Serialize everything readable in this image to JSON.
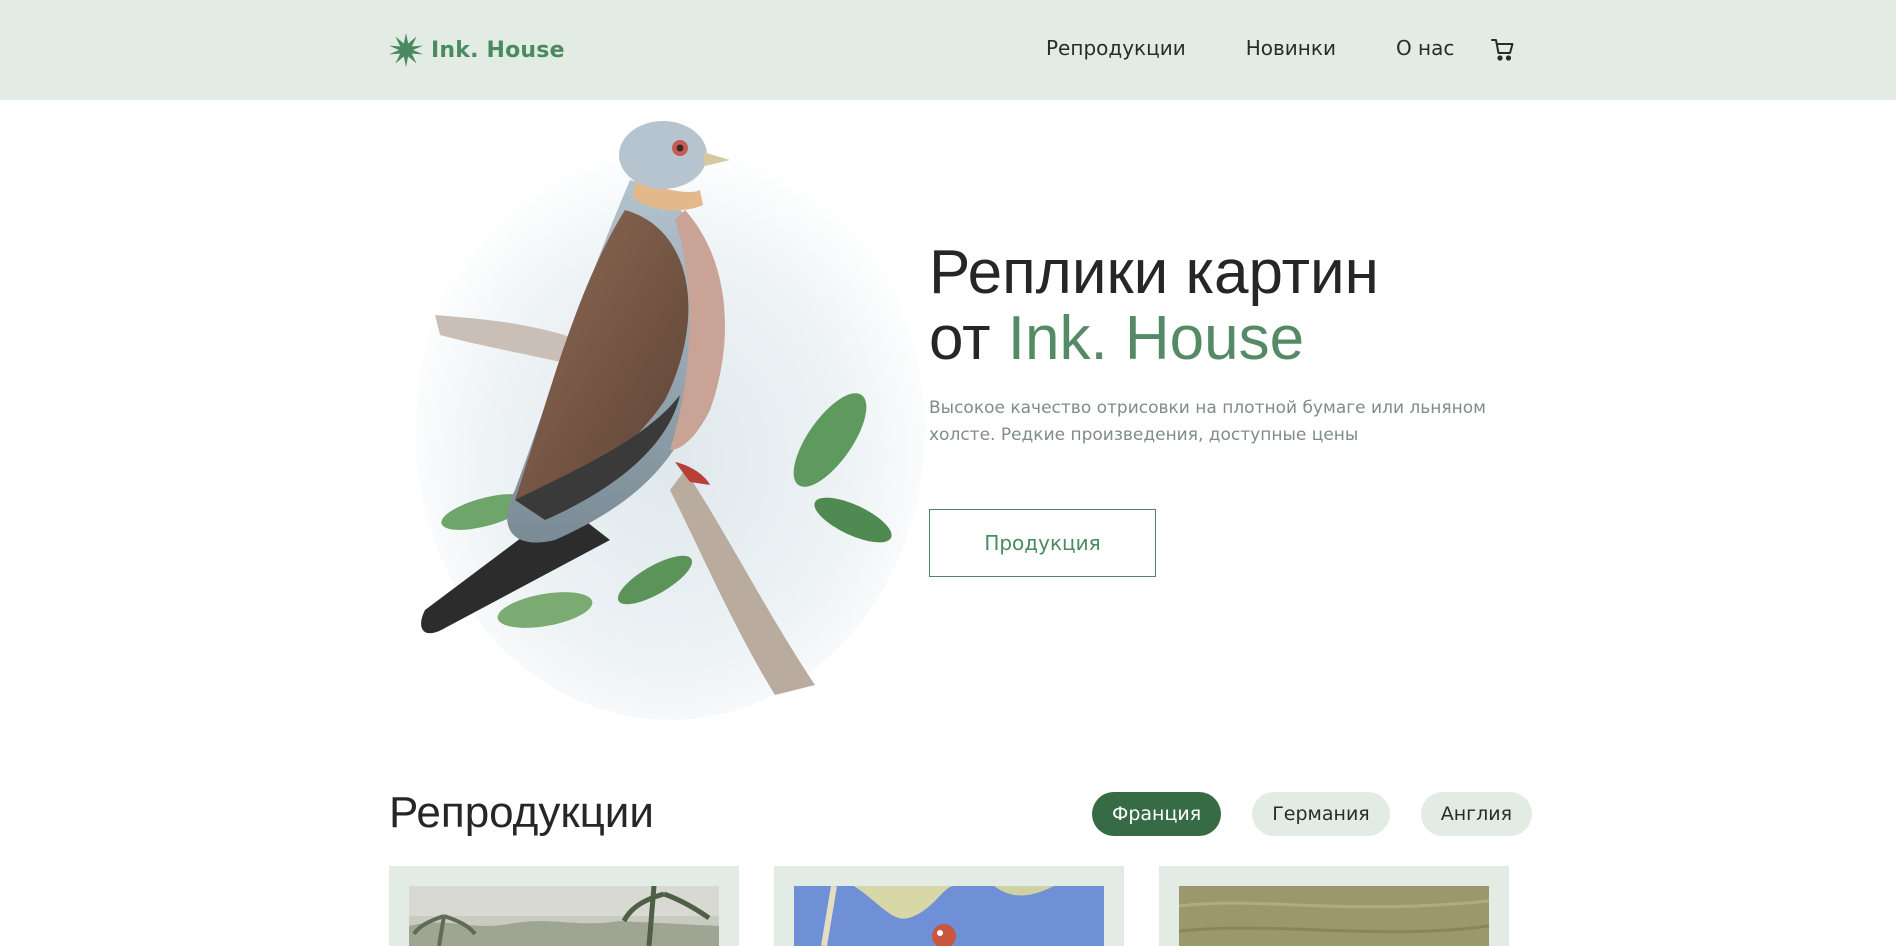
{
  "header": {
    "logo_text": "Ink. House",
    "nav": [
      {
        "label": "Репродукции"
      },
      {
        "label": "Новинки"
      },
      {
        "label": "О нас"
      }
    ]
  },
  "hero": {
    "title_line1": "Реплики картин",
    "title_prefix": "от",
    "title_accent": "Ink. House",
    "description": "Высокое качество отрисовки на плотной бумаге или льняном холсте. Редкие произведения, доступные цены",
    "button_label": "Продукция"
  },
  "catalog": {
    "title": "Репродукции",
    "filters": [
      {
        "label": "Франция",
        "active": true
      },
      {
        "label": "Германия",
        "active": false
      },
      {
        "label": "Англия",
        "active": false
      }
    ]
  },
  "colors": {
    "accent": "#4b8a61",
    "header_bg": "#e2ece5",
    "active_filter": "#366b45"
  }
}
